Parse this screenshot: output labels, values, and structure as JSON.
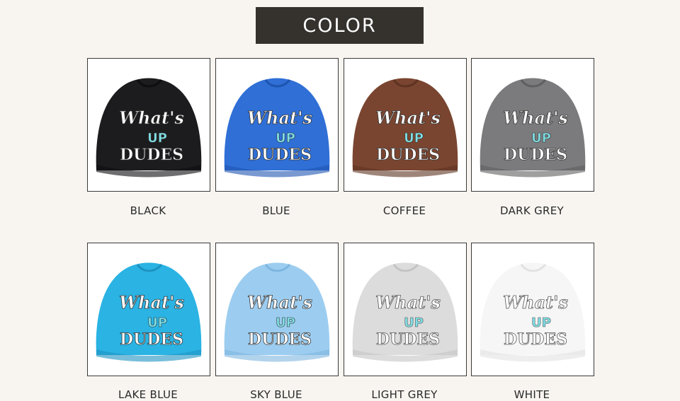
{
  "header": {
    "title": "COLOR"
  },
  "logo_text": {
    "line1": "What's",
    "line2": "UP",
    "line3": "DUDES"
  },
  "products": [
    {
      "label": "BLACK",
      "color": "#1c1c1e",
      "shade": "#0e0e10",
      "row": 0,
      "col": 0
    },
    {
      "label": "BLUE",
      "color": "#2f6fd6",
      "shade": "#1f55b0",
      "row": 0,
      "col": 1
    },
    {
      "label": "COFFEE",
      "color": "#7a4530",
      "shade": "#5e3322",
      "row": 0,
      "col": 2
    },
    {
      "label": "DARK GREY",
      "color": "#7b7b7d",
      "shade": "#5f5f61",
      "row": 0,
      "col": 3
    },
    {
      "label": "LAKE BLUE",
      "color": "#2ab3e3",
      "shade": "#1e93c1",
      "row": 1,
      "col": 0
    },
    {
      "label": "SKY BLUE",
      "color": "#9ccdf0",
      "shade": "#7eb6e0",
      "row": 1,
      "col": 1
    },
    {
      "label": "LIGHT GREY",
      "color": "#dcdcdc",
      "shade": "#c4c4c4",
      "row": 1,
      "col": 2
    },
    {
      "label": "WHITE",
      "color": "#f6f6f6",
      "shade": "#e2e2e2",
      "row": 1,
      "col": 3
    }
  ]
}
